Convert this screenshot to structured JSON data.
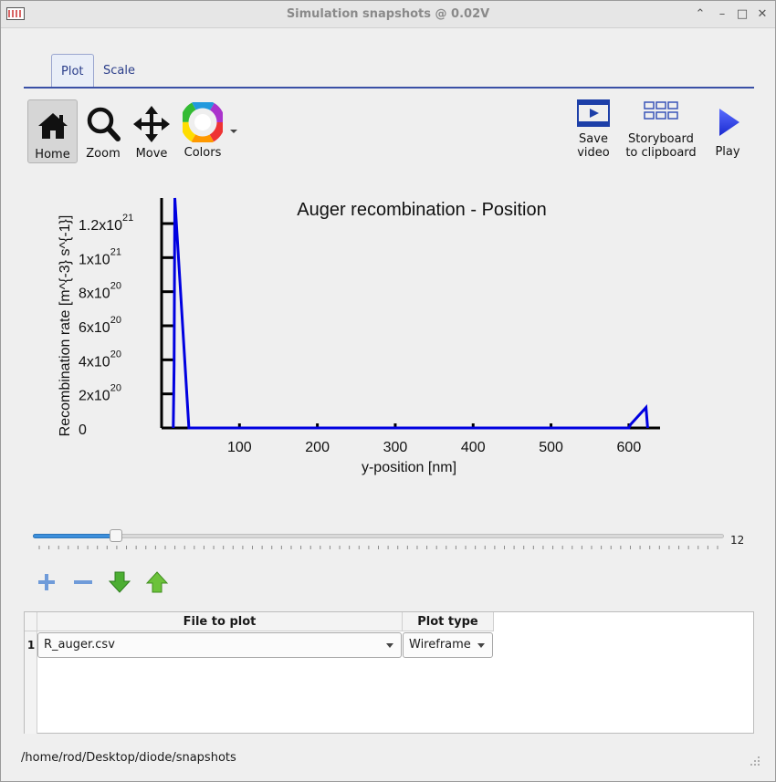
{
  "window": {
    "title": "Simulation snapshots @ 0.02V"
  },
  "tabs": [
    {
      "label": "Plot"
    },
    {
      "label": "Scale"
    }
  ],
  "toolbar": {
    "home": "Home",
    "zoom": "Zoom",
    "move": "Move",
    "colors": "Colors",
    "save_video_1": "Save",
    "save_video_2": "video",
    "storyboard_1": "Storyboard",
    "storyboard_2": "to clipboard",
    "play": "Play"
  },
  "chart_data": {
    "type": "line",
    "title": "Auger recombination - Position",
    "xlabel": "y-position [nm]",
    "ylabel": "Recombination rate [m^{-3} s^{-1}]",
    "xlim": [
      0,
      640
    ],
    "ylim": [
      0,
      1.35e+21
    ],
    "x_ticks": [
      100,
      200,
      300,
      400,
      500,
      600
    ],
    "y_ticks": [
      {
        "value": 0,
        "base": "0",
        "exp": ""
      },
      {
        "value": 2e+20,
        "base": "2x10",
        "exp": "20"
      },
      {
        "value": 4e+20,
        "base": "4x10",
        "exp": "20"
      },
      {
        "value": 6e+20,
        "base": "6x10",
        "exp": "20"
      },
      {
        "value": 8e+20,
        "base": "8x10",
        "exp": "20"
      },
      {
        "value": 1e+21,
        "base": "1x10",
        "exp": "21"
      },
      {
        "value": 1.2e+21,
        "base": "1.2x10",
        "exp": "21"
      }
    ],
    "series": [
      {
        "color": "#0000e0",
        "x": [
          15,
          16,
          17,
          35,
          100,
          200,
          300,
          400,
          500,
          600,
          602,
          622,
          624
        ],
        "y": [
          0,
          3.7e+20,
          1.35e+21,
          0,
          0,
          0,
          0,
          0,
          0,
          0,
          2e+19,
          1.2e+20,
          0
        ]
      }
    ],
    "grid": false
  },
  "slider": {
    "value": "12",
    "fraction": 0.12
  },
  "table": {
    "headers": [
      "File to plot",
      "Plot type"
    ],
    "rows": [
      {
        "index": "1",
        "file": "R_auger.csv",
        "type": "Wireframe"
      }
    ]
  },
  "status": {
    "path": "/home/rod/Desktop/diode/snapshots"
  }
}
